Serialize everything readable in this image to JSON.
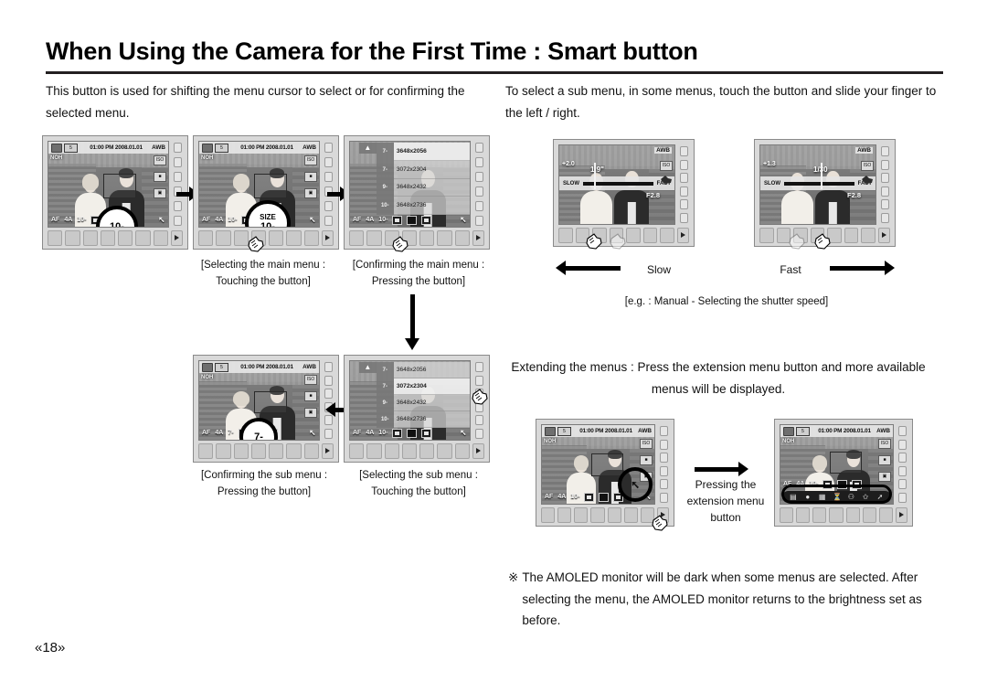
{
  "page": {
    "title": "When Using the Camera for the First Time : Smart button",
    "page_number": "«18»"
  },
  "intro": {
    "left": "This button is used for shifting the menu cursor to select or for confirming the selected menu.",
    "right": "To select a sub menu, in some menus, touch the button and slide your finger to the left / right."
  },
  "captions": {
    "selecting_main_menu": "[Selecting the main menu : Touching the button]",
    "confirming_main_menu": "[Confirming the main menu : Pressing the button]",
    "confirming_sub_menu": "[Confirming the sub menu : Pressing the button]",
    "selecting_sub_menu": "[Selecting the sub menu : Touching the button]",
    "shutter_example": "[e.g. : Manual - Selecting the shutter speed]"
  },
  "slider_labels": {
    "slow": "Slow",
    "fast": "Fast"
  },
  "extension": {
    "heading": "Extending the menus : Press the extension menu button and more available menus will be displayed.",
    "button_caption": "Pressing the extension menu button"
  },
  "note": {
    "symbol": "※",
    "text": "The AMOLED monitor will be dark when some menus are selected. After selecting the menu, the AMOLED monitor returns to the brightness set as before."
  },
  "camera": {
    "status": {
      "timestamp": "01:00 PM 2008.01.01",
      "awb": "AWB",
      "battery": "5",
      "noh": "NOH"
    },
    "osd": {
      "af": "AF",
      "flash": "4A",
      "size_10m": "10-",
      "size_7m": "7-",
      "ext_icon": "ext-menu-icon"
    },
    "size_label": "SIZE",
    "resolution_menu": {
      "items": [
        {
          "icon": "7-",
          "label": "3648x2056"
        },
        {
          "icon": "7-",
          "label": "3072x2304"
        },
        {
          "icon": "9-",
          "label": "3648x2432"
        },
        {
          "icon": "10-",
          "label": "3648x2736"
        }
      ],
      "selected_index_top": 0,
      "selected_index_bottom": 1
    },
    "shutter": {
      "slow_label": "SLOW",
      "fast_label": "FAST",
      "screen_a": {
        "ev": "+2.0",
        "speed": "1.9\"",
        "aperture": "F2.8",
        "awb": "AWB"
      },
      "screen_b": {
        "ev": "+1.3",
        "speed": "1/30",
        "aperture": "F2.8",
        "awb": "AWB"
      }
    },
    "extension_menu_icons": [
      "scene-icon",
      "color-icon",
      "grid-icon",
      "timer-icon",
      "voice-icon",
      "brush-icon",
      "ext-menu-icon"
    ]
  }
}
